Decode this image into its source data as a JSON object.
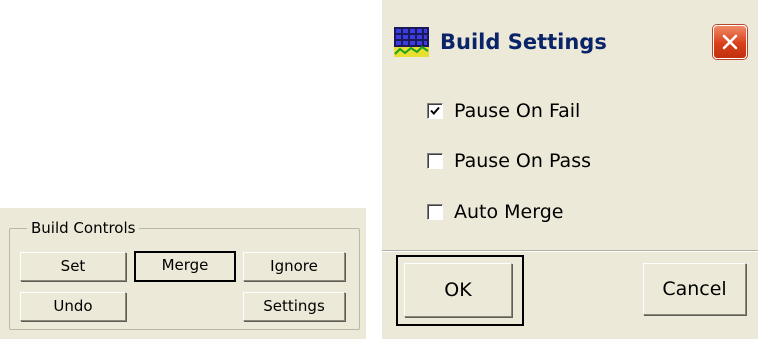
{
  "build_controls": {
    "group_title": "Build Controls",
    "buttons": {
      "set": "Set",
      "merge": "Merge",
      "ignore": "Ignore",
      "undo": "Undo",
      "settings": "Settings"
    }
  },
  "build_settings_dialog": {
    "title": "Build Settings",
    "icon": "graph-grid-icon",
    "options": [
      {
        "label": "Pause On Fail",
        "checked": true
      },
      {
        "label": "Pause On Pass",
        "checked": false
      },
      {
        "label": "Auto Merge",
        "checked": false
      }
    ],
    "buttons": {
      "ok": "OK",
      "cancel": "Cancel"
    },
    "colors": {
      "title_text": "#0a246a",
      "close_button": "#d8401a",
      "dialog_background": "#ece9d8"
    }
  }
}
